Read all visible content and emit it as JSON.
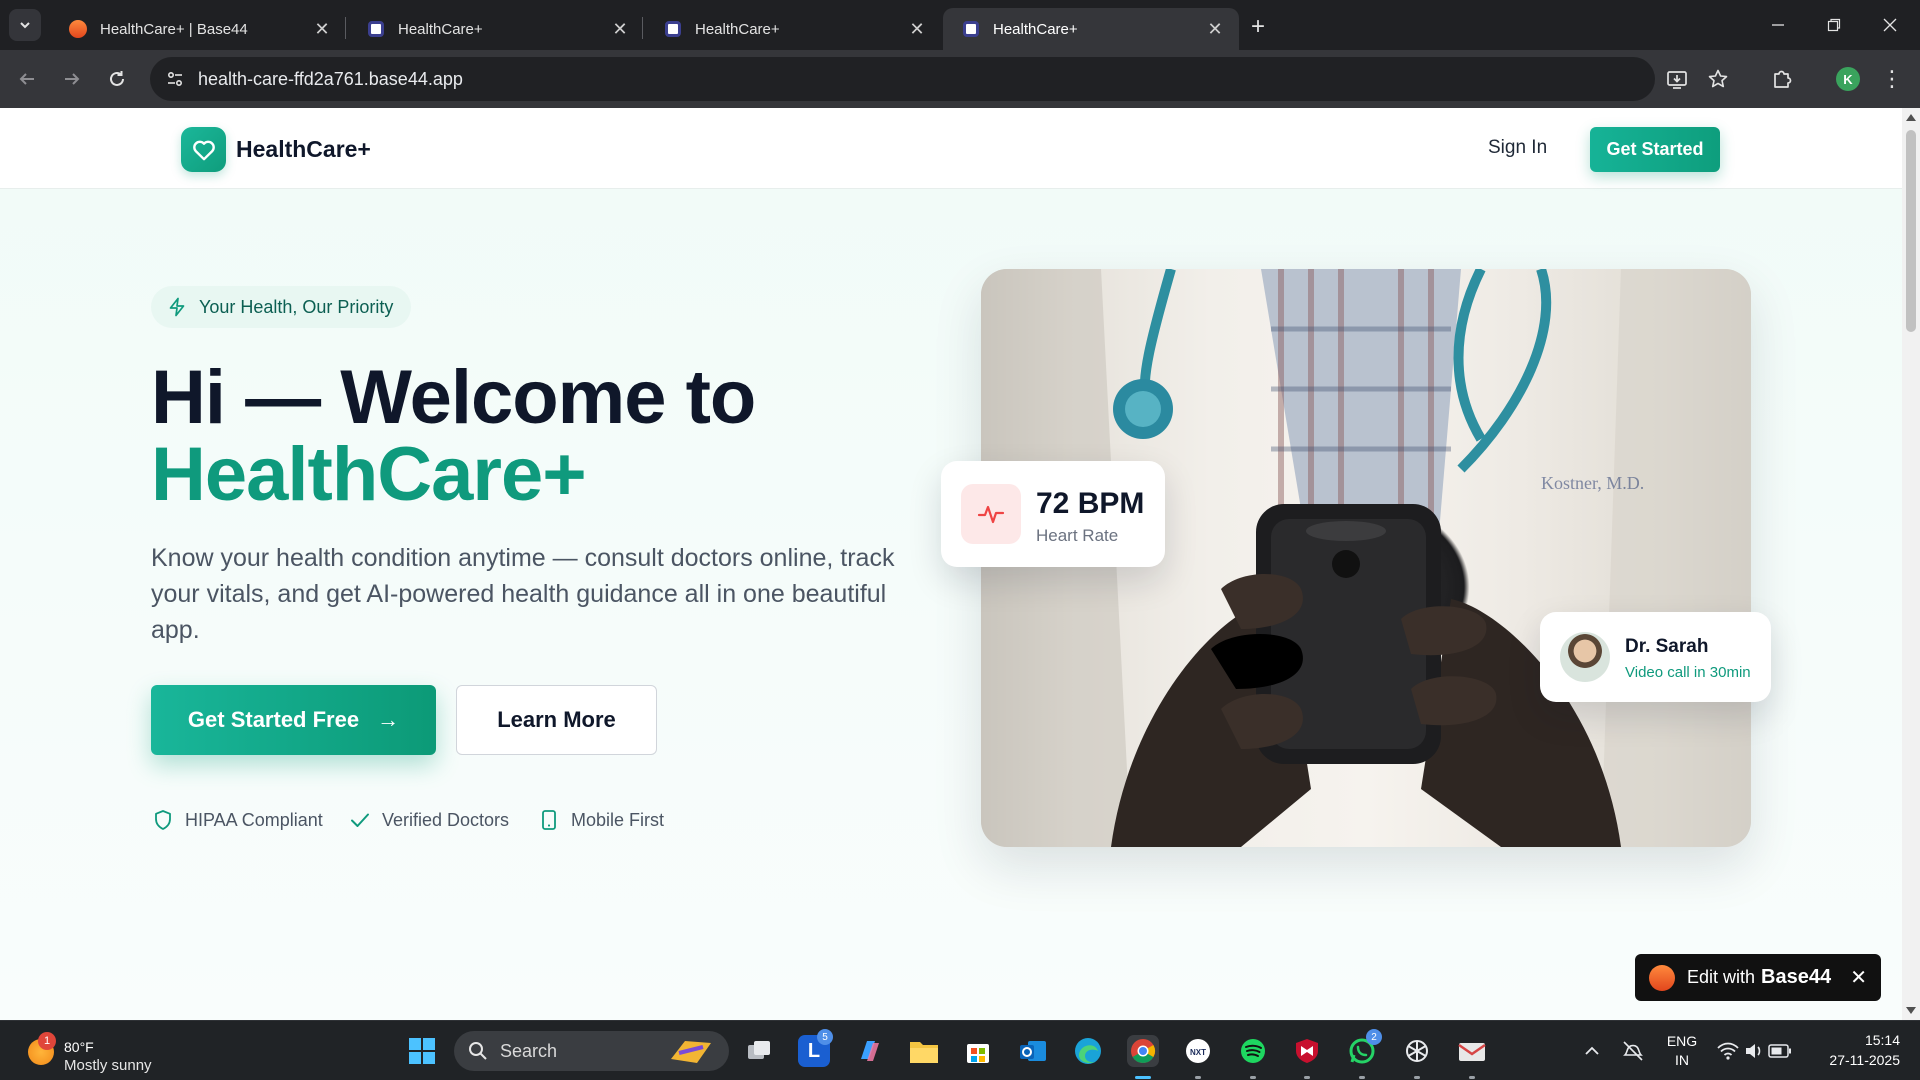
{
  "browser": {
    "tabs": [
      {
        "title": "HealthCare+ | Base44",
        "favicon": "base44-favicon",
        "active": false
      },
      {
        "title": "HealthCare+",
        "favicon": "app-favicon",
        "active": false
      },
      {
        "title": "HealthCare+",
        "favicon": "app-favicon",
        "active": false
      },
      {
        "title": "HealthCare+",
        "favicon": "app-favicon",
        "active": true
      }
    ],
    "url": "health-care-ffd2a761.base44.app",
    "profile_initial": "K"
  },
  "header": {
    "brand": "HealthCare+",
    "sign_in": "Sign In",
    "get_started": "Get Started"
  },
  "hero": {
    "badge": "Your Health, Our Priority",
    "headline_line1": "Hi — Welcome to",
    "headline_line2": "HealthCare+",
    "description": "Know your health condition anytime — consult doctors online, track your vitals, and get AI-powered health guidance all in one beautiful app.",
    "primary_cta": "Get Started Free",
    "secondary_cta": "Learn More",
    "features": [
      {
        "label": "HIPAA Compliant",
        "icon": "shield-icon"
      },
      {
        "label": "Verified Doctors",
        "icon": "check-icon"
      },
      {
        "label": "Mobile First",
        "icon": "smartphone-icon"
      }
    ]
  },
  "cards": {
    "heart_value": "72 BPM",
    "heart_label": "Heart Rate",
    "doctor_name": "Dr. Sarah",
    "doctor_status": "Video call in 30min"
  },
  "edit_badge": {
    "prefix": "Edit with",
    "brand": "Base44"
  },
  "taskbar": {
    "weather_temp": "80°F",
    "weather_desc": "Mostly sunny",
    "weather_badge": "1",
    "search_placeholder": "Search",
    "language": "ENG",
    "region": "IN",
    "time": "15:14",
    "date": "27-11-2025",
    "outlook_badge": "5",
    "whatsapp_badge": "2"
  },
  "colors": {
    "brand_teal": "#0f9a7d",
    "heading_dark": "#0f172a",
    "heart_red": "#ef4444"
  }
}
